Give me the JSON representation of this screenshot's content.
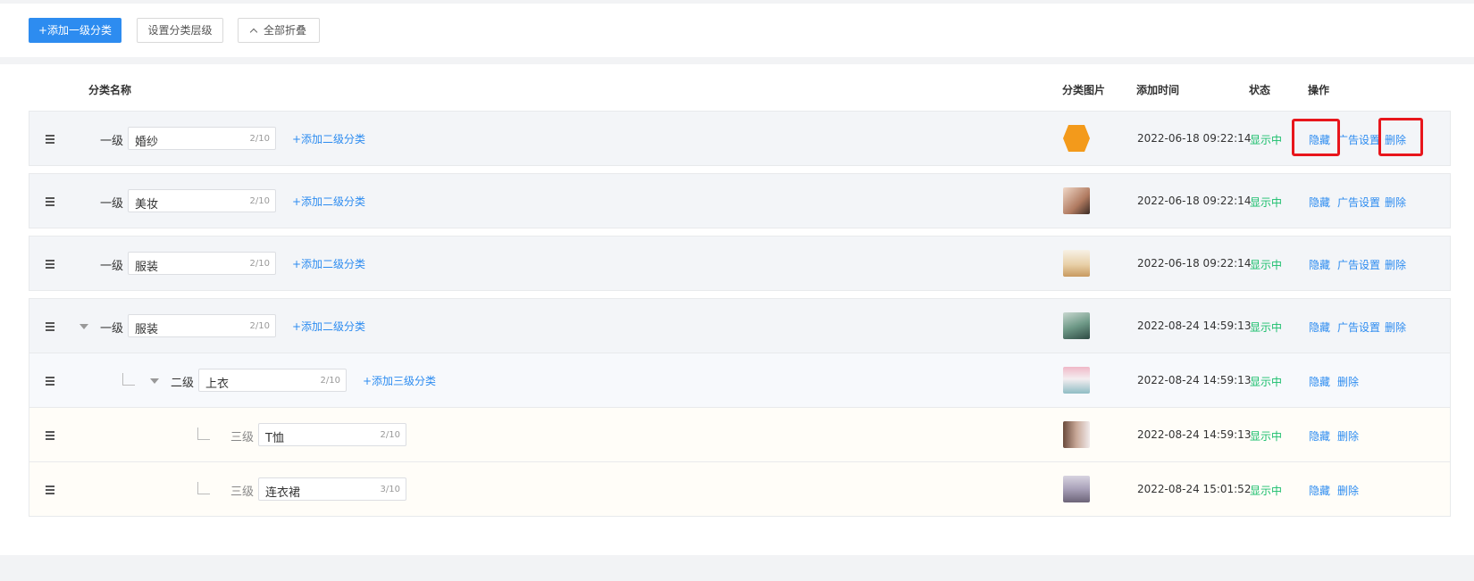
{
  "toolbar": {
    "add_top_label": "+添加一级分类",
    "set_levels_label": "设置分类层级",
    "collapse_all_label": "全部折叠"
  },
  "columns": {
    "name": "分类名称",
    "image": "分类图片",
    "added_time": "添加时间",
    "status": "状态",
    "actions": "操作"
  },
  "rows": [
    {
      "level_label": "一级",
      "name": "婚纱",
      "count": "2/10",
      "add_child": "+添加二级分类",
      "time": "2022-06-18 09:22:14",
      "status": "显示中",
      "hide": "隐藏",
      "ad": "广告设置",
      "del": "删除",
      "thumb_color": "#f39a1b"
    },
    {
      "level_label": "一级",
      "name": "美妆",
      "count": "2/10",
      "add_child": "+添加二级分类",
      "time": "2022-06-18 09:22:14",
      "status": "显示中",
      "hide": "隐藏",
      "ad": "广告设置",
      "del": "删除",
      "thumb_color": "#d9a48a"
    },
    {
      "level_label": "一级",
      "name": "服装",
      "count": "2/10",
      "add_child": "+添加二级分类",
      "time": "2022-06-18 09:22:14",
      "status": "显示中",
      "hide": "隐藏",
      "ad": "广告设置",
      "del": "删除",
      "thumb_color": "#e8d6b8"
    },
    {
      "level_label": "一级",
      "name": "服装",
      "count": "2/10",
      "add_child": "+添加二级分类",
      "time": "2022-08-24 14:59:13",
      "status": "显示中",
      "hide": "隐藏",
      "ad": "广告设置",
      "del": "删除",
      "thumb_color": "#7d9c8c"
    },
    {
      "level_label": "二级",
      "name": "上衣",
      "count": "2/10",
      "add_child": "+添加三级分类",
      "time": "2022-08-24 14:59:13",
      "status": "显示中",
      "hide": "隐藏",
      "del": "删除",
      "thumb_color": "#d8c0c8"
    },
    {
      "level_label": "三级",
      "name": "T恤",
      "count": "2/10",
      "time": "2022-08-24 14:59:13",
      "status": "显示中",
      "hide": "隐藏",
      "del": "删除",
      "thumb_color": "#8a6a5c"
    },
    {
      "level_label": "三级",
      "name": "连衣裙",
      "count": "3/10",
      "time": "2022-08-24 15:01:52",
      "status": "显示中",
      "hide": "隐藏",
      "del": "删除",
      "thumb_color": "#a8a4b4"
    }
  ],
  "colors": {
    "primary": "#2d8cf0",
    "status_green": "#19be6b",
    "highlight_red": "#e8161c"
  }
}
